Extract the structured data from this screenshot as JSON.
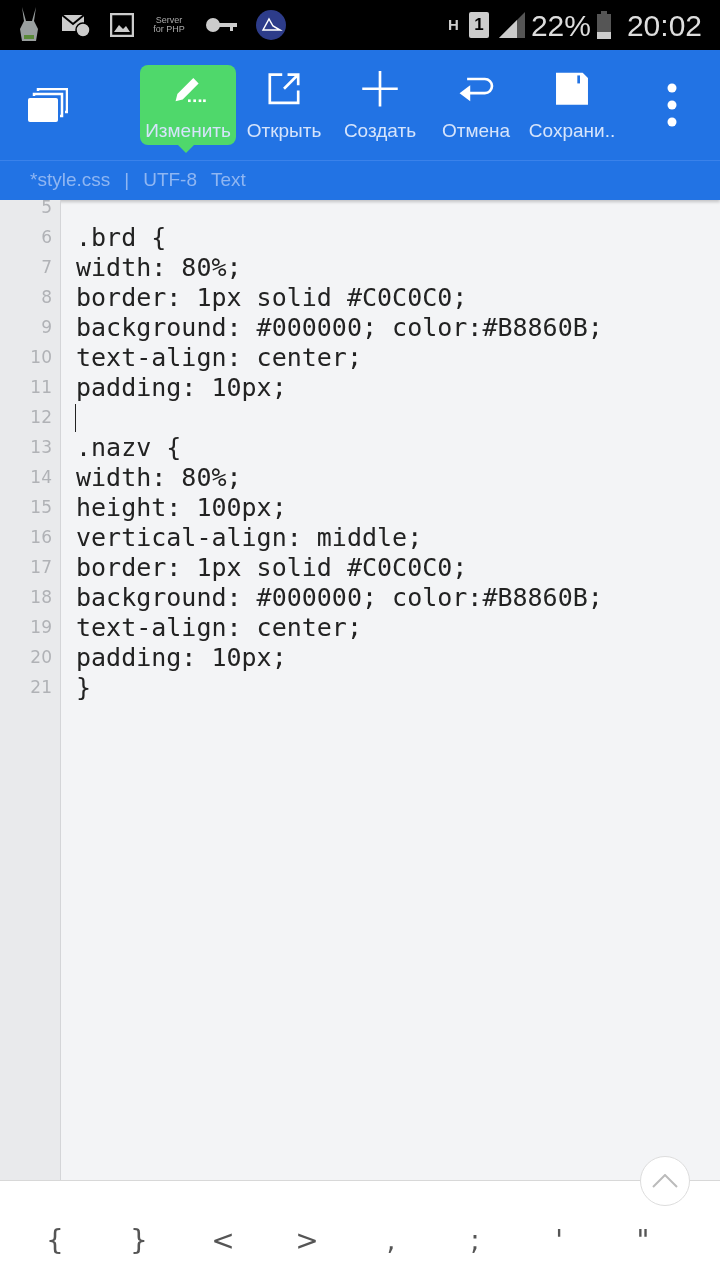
{
  "status_bar": {
    "server_icon_text": "Server for PHP",
    "network": "H",
    "sim": "1",
    "battery": "22%",
    "time": "20:02"
  },
  "toolbar": {
    "actions": [
      {
        "kind": "edit",
        "label": "Изменить",
        "selected": true
      },
      {
        "kind": "open",
        "label": "Открыть",
        "selected": false
      },
      {
        "kind": "new",
        "label": "Создать",
        "selected": false
      },
      {
        "kind": "undo",
        "label": "Отмена",
        "selected": false
      },
      {
        "kind": "save",
        "label": "Сохрани..",
        "selected": false
      }
    ]
  },
  "file_bar": {
    "file": "*style.css",
    "separator": "|",
    "encoding": "UTF-8",
    "mode": "Text"
  },
  "editor": {
    "lines": [
      {
        "number": "5",
        "cursor": false
      },
      {
        "number": "6",
        "text": ".brd {",
        "cursor": false
      },
      {
        "number": "7",
        "text": "width: 80%;",
        "cursor": false
      },
      {
        "number": "8",
        "text": "border: 1px solid #C0C0C0;",
        "cursor": false
      },
      {
        "number": "9",
        "text": "background: #000000; color:#B8860B;",
        "cursor": false
      },
      {
        "number": "10",
        "text": "text-align: center;",
        "cursor": false
      },
      {
        "number": "11",
        "text": "padding: 10px;",
        "cursor": false
      },
      {
        "number": "12",
        "cursor": true
      },
      {
        "number": "13",
        "text": ".nazv {",
        "cursor": false
      },
      {
        "number": "14",
        "text": "width: 80%;",
        "cursor": false
      },
      {
        "number": "15",
        "text": "height: 100px;",
        "cursor": false
      },
      {
        "number": "16",
        "text": "vertical-align: middle;",
        "cursor": false
      },
      {
        "number": "17",
        "text": "border: 1px solid #C0C0C0;",
        "cursor": false
      },
      {
        "number": "18",
        "text": "background: #000000; color:#B8860B;",
        "cursor": false
      },
      {
        "number": "19",
        "text": "text-align: center;",
        "cursor": false
      },
      {
        "number": "20",
        "text": "padding: 10px;",
        "cursor": false
      },
      {
        "number": "21",
        "text": "}",
        "cursor": false
      }
    ]
  },
  "symbol_bar": {
    "keys": [
      "{",
      "}",
      "<",
      ">",
      ",",
      ";",
      "'",
      "\""
    ]
  }
}
